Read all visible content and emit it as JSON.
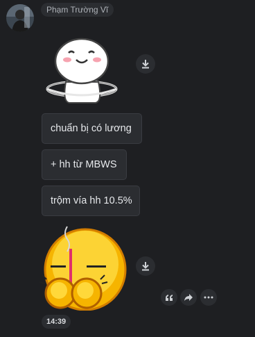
{
  "sender": {
    "name": "Phạm Trường Vĩ",
    "avatar_icon": "avatar-photo"
  },
  "messages": [
    {
      "type": "sticker",
      "icon": "hula-hoop-bun-sticker"
    },
    {
      "type": "text",
      "text": "chuẩn bị có lương"
    },
    {
      "type": "text",
      "text": "+ hh từ MBWS"
    },
    {
      "type": "text",
      "text": "trộm vía hh 10.5%"
    },
    {
      "type": "sticker",
      "icon": "incense-praying-emoji-sticker"
    }
  ],
  "actions": {
    "quote_icon": "quote-icon",
    "forward_icon": "forward-icon",
    "more_icon": "more-icon",
    "download_icon": "download-icon"
  },
  "timestamp": "14:39",
  "colors": {
    "background": "#1e1f22",
    "bubble": "#2b2d31",
    "text": "#e7e9ec"
  }
}
